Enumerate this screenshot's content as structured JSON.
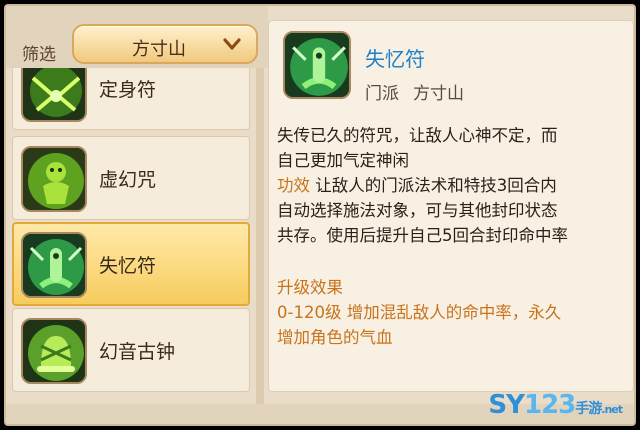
{
  "filter": {
    "label": "筛选",
    "selected": "方寸山"
  },
  "skills": [
    {
      "name": "定身符",
      "icon": "sealing-talisman-icon"
    },
    {
      "name": "虚幻咒",
      "icon": "phantom-spell-icon"
    },
    {
      "name": "失忆符",
      "icon": "amnesia-talisman-icon",
      "selected": true
    },
    {
      "name": "幻音古钟",
      "icon": "ancient-bell-icon"
    }
  ],
  "detail": {
    "title": "失忆符",
    "school_key": "门派",
    "school_value": "方寸山",
    "desc_line1": "失传已久的符咒，让敌人心神不定，而",
    "desc_line2": "自己更加气定神闲",
    "effect_key": "功效",
    "effect_line1": " 让敌人的门派法术和特技3回合内",
    "effect_line2": "自动选择施法对象，可与其他封印状态",
    "effect_line3": "共存。使用后提升自己5回合封印命中率",
    "upgrade_title": "升级效果",
    "upgrade_line1": "0-120级 增加混乱敌人的命中率，永久",
    "upgrade_line2": "增加角色的气血"
  },
  "watermark": {
    "sy": "SY",
    "num": "123",
    "cn": "手游",
    "net": ".net"
  },
  "colors": {
    "title_blue": "#1f7fc7",
    "highlight_orange": "#c7741d",
    "selected_bg": "#f7cc5e"
  }
}
